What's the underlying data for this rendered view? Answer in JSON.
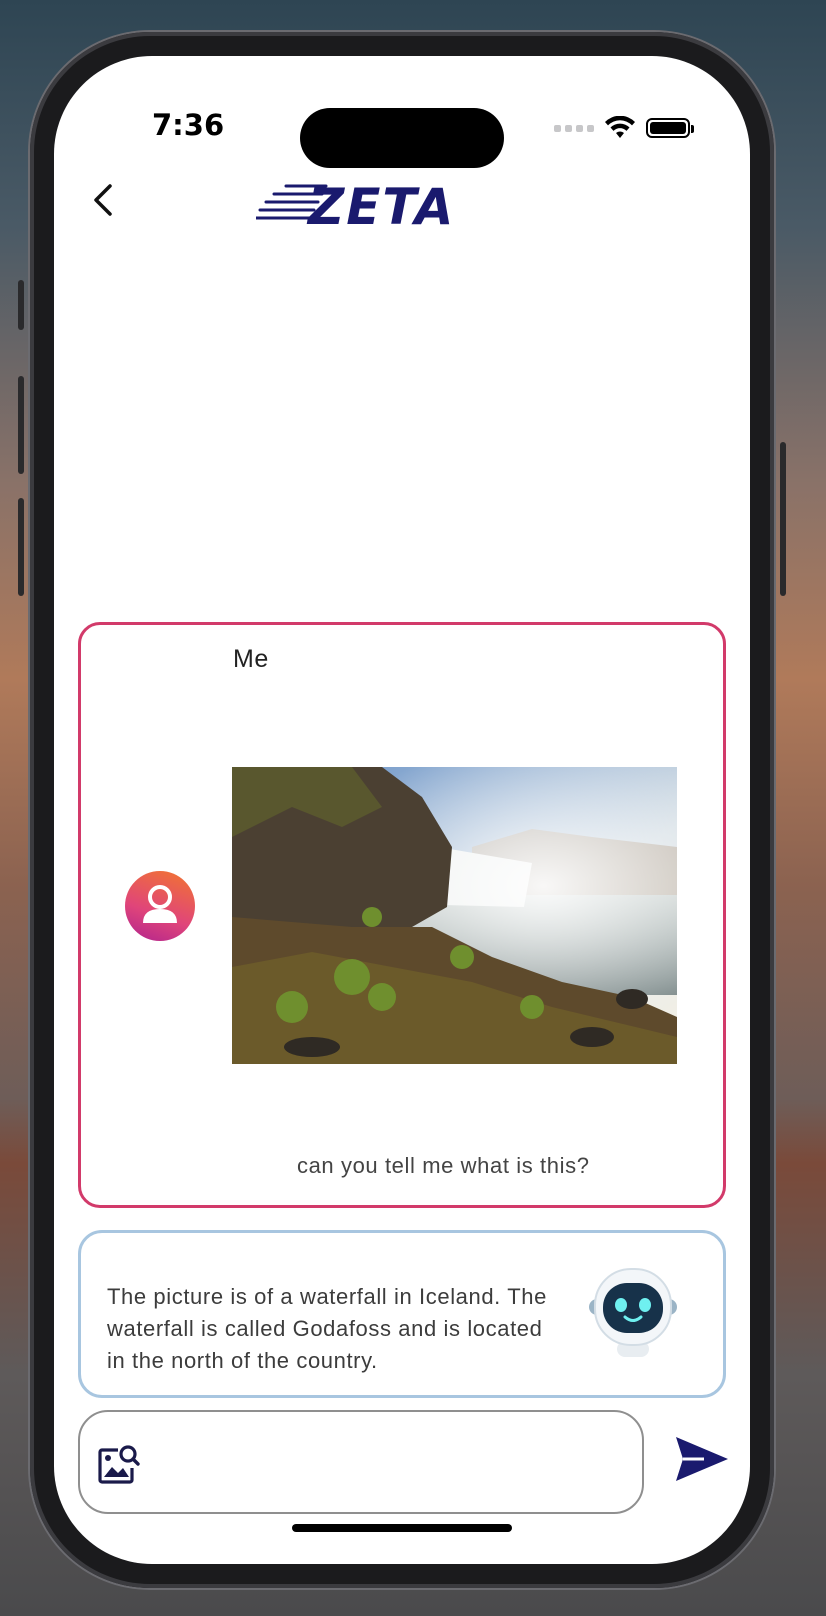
{
  "status_bar": {
    "time": "7:36"
  },
  "header": {
    "logo_text": "ZETA",
    "brand_color": "#1a1a6e",
    "back_icon": "chevron-left-icon"
  },
  "messages": {
    "user": {
      "author": "Me",
      "image": "waterfall-photo",
      "text": "can you tell me what is this?",
      "border_color": "#d23a6a"
    },
    "bot": {
      "text": "The picture is of a waterfall in Iceland. The waterfall is called Godafoss and is located in the north of the country.",
      "avatar": "robot-icon",
      "border_color": "#a8c6e0"
    }
  },
  "composer": {
    "value": "",
    "attach_icon": "image-search-icon",
    "send_icon": "send-icon"
  }
}
